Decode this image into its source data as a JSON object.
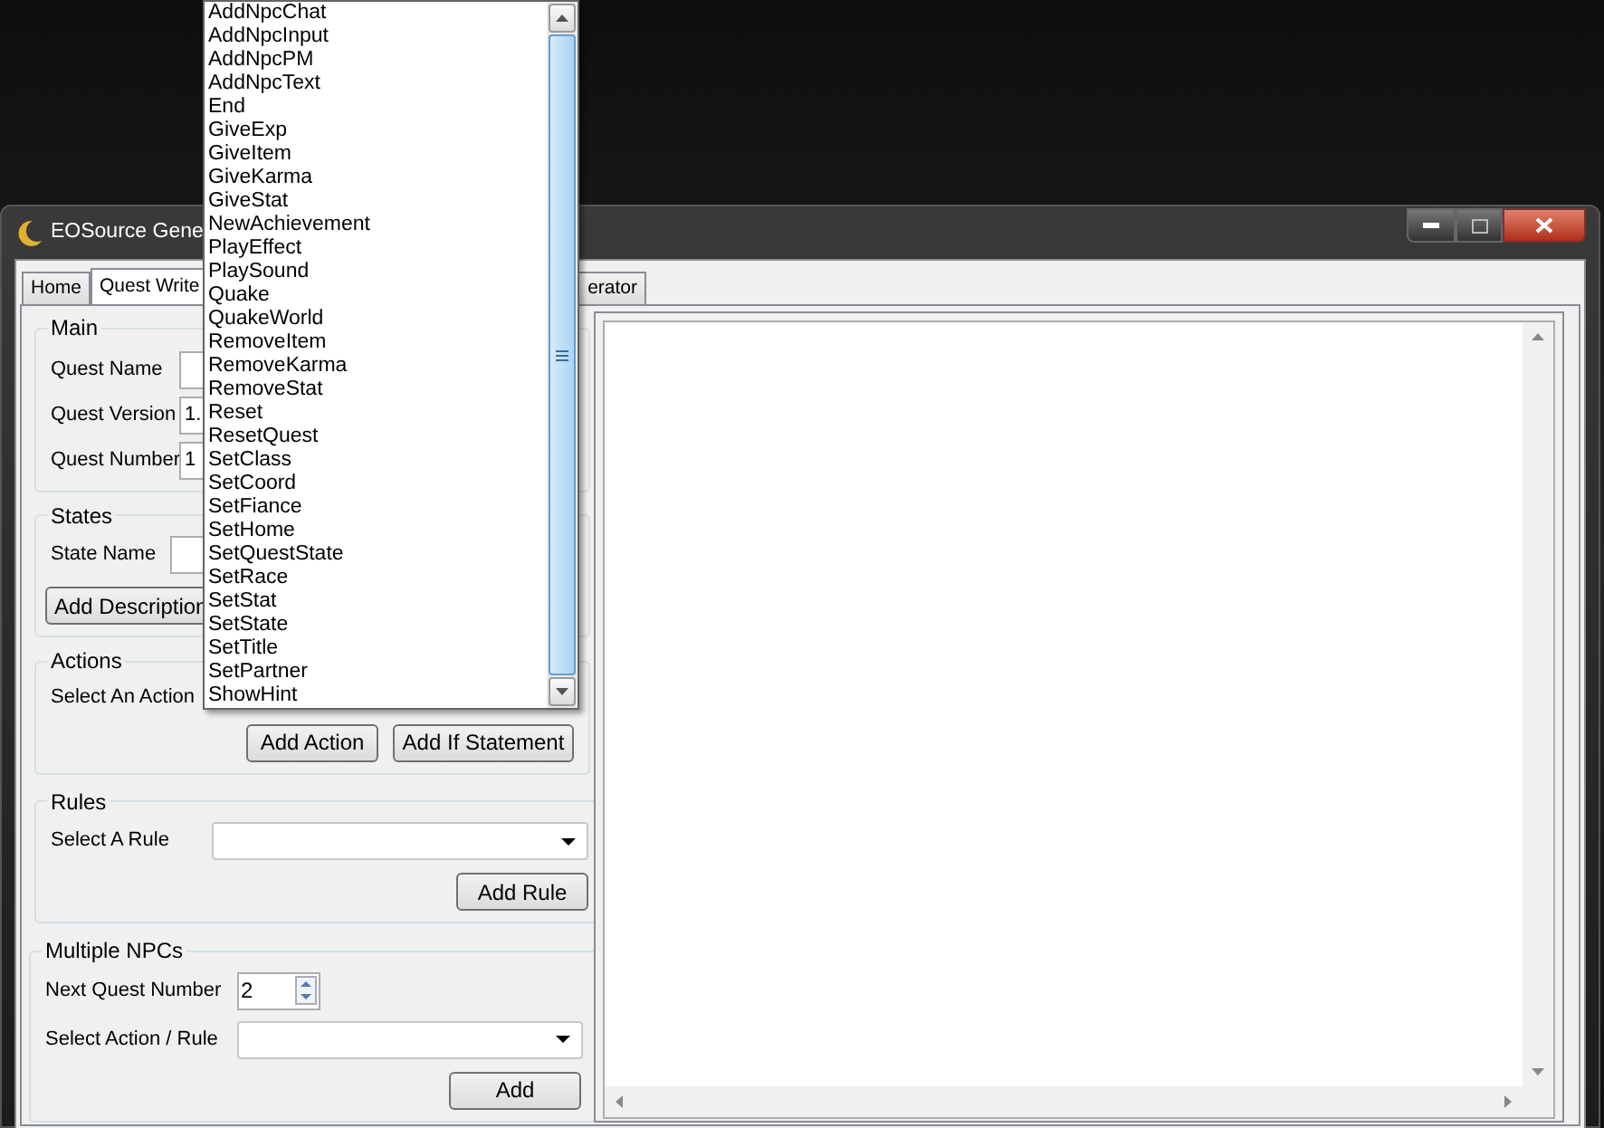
{
  "window": {
    "title": "EOSource Gene"
  },
  "tabs": [
    {
      "label": "Home",
      "selected": false
    },
    {
      "label": "Quest Write",
      "selected": true
    },
    {
      "label": "erator",
      "selected": false
    }
  ],
  "main": {
    "title": "Main",
    "fields": [
      {
        "label": "Quest Name"
      },
      {
        "label": "Quest Version",
        "value": "1."
      },
      {
        "label": "Quest Number",
        "value": "1"
      }
    ]
  },
  "states": {
    "title": "States",
    "field_label": "State Name",
    "button": "Add Description"
  },
  "actions": {
    "title": "Actions",
    "select_label": "Select An Action",
    "buttons": [
      "Add Action",
      "Add If Statement"
    ]
  },
  "rules": {
    "title": "Rules",
    "select_label": "Select A Rule",
    "button": "Add Rule"
  },
  "multiple_npcs": {
    "title": "Multiple NPCs",
    "next_quest_label": "Next Quest Number",
    "next_quest_value": "2",
    "select_label": "Select Action / Rule",
    "button": "Add"
  },
  "action_dropdown": {
    "items": [
      "AddNpcChat",
      "AddNpcInput",
      "AddNpcPM",
      "AddNpcText",
      "End",
      "GiveExp",
      "GiveItem",
      "GiveKarma",
      "GiveStat",
      "NewAchievement",
      "PlayEffect",
      "PlaySound",
      "Quake",
      "QuakeWorld",
      "RemoveItem",
      "RemoveKarma",
      "RemoveStat",
      "Reset",
      "ResetQuest",
      "SetClass",
      "SetCoord",
      "SetFiance",
      "SetHome",
      "SetQuestState",
      "SetRace",
      "SetStat",
      "SetState",
      "SetTitle",
      "SetPartner",
      "ShowHint"
    ]
  }
}
